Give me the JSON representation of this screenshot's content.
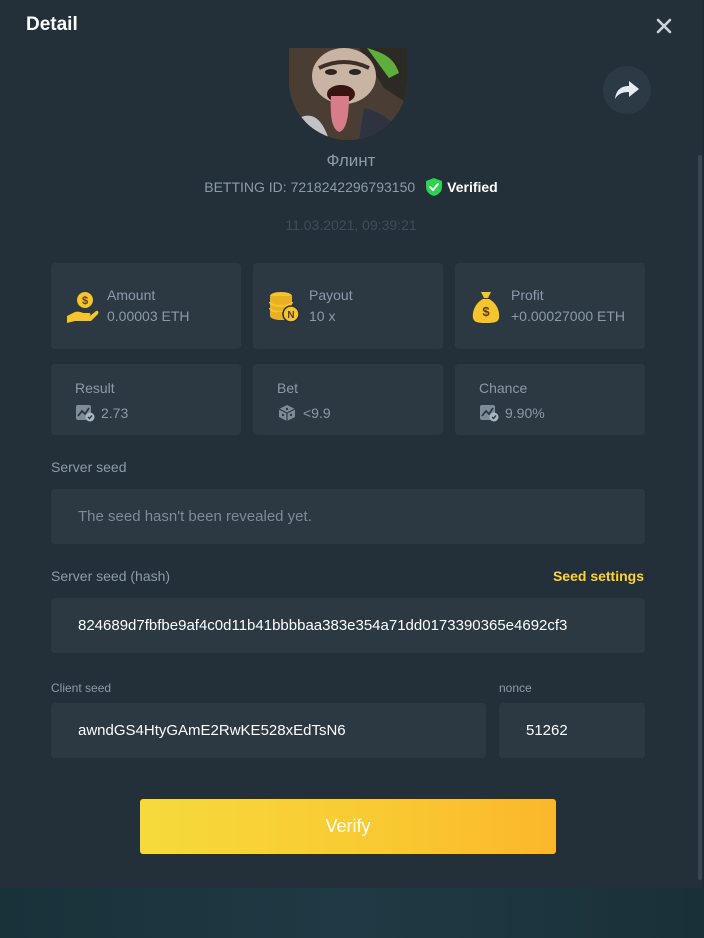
{
  "header": {
    "title": "Detail",
    "close_icon": "close-icon"
  },
  "profile": {
    "username": "Флинт",
    "betting_id_label": "BETTING ID: 7218242296793150",
    "verified_label": "Verified",
    "datetime": "11.03.2021, 09:39:21",
    "share_icon": "share-icon"
  },
  "stats": {
    "amount": {
      "label": "Amount",
      "value": "0.00003 ETH",
      "icon": "coin-hand-icon"
    },
    "payout": {
      "label": "Payout",
      "value": "10 x",
      "icon": "coin-stack-icon"
    },
    "profit": {
      "label": "Profit",
      "value": "+0.00027000 ETH",
      "icon": "money-bag-icon"
    },
    "result": {
      "label": "Result",
      "value": "2.73",
      "icon": "chart-check-icon"
    },
    "bet": {
      "label": "Bet",
      "value": "<9.9",
      "icon": "dice-icon"
    },
    "chance": {
      "label": "Chance",
      "value": "9.90%",
      "icon": "chart-check-icon"
    }
  },
  "server_seed": {
    "label": "Server seed",
    "value": "The seed hasn't been revealed yet."
  },
  "server_seed_hash": {
    "label": "Server seed (hash)",
    "settings_link": "Seed settings",
    "value": "824689d7fbfbe9af4c0d11b41bbbbaa383e354a71dd0173390365e4692cf3"
  },
  "client_seed": {
    "label": "Client seed",
    "value": "awndGS4HtyGAmE2RwKE528xEdTsN6"
  },
  "nonce": {
    "label": "nonce",
    "value": "51262"
  },
  "verify_button": {
    "label": "Verify"
  },
  "colors": {
    "accent_yellow": "#ffd430",
    "verified_green": "#2bd34f",
    "panel": "#243039",
    "card": "#2c3842"
  }
}
